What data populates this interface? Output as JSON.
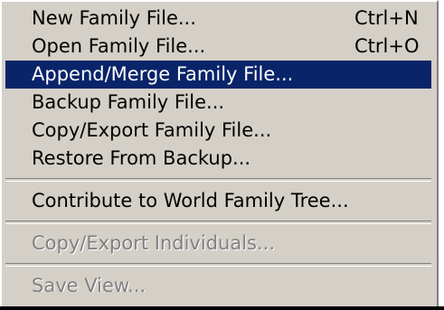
{
  "menu": {
    "items": [
      {
        "label": "New Family File...",
        "shortcut": "Ctrl+N"
      },
      {
        "label": "Open Family File...",
        "shortcut": "Ctrl+O"
      },
      {
        "label": "Append/Merge Family File..."
      },
      {
        "label": "Backup Family File..."
      },
      {
        "label": "Copy/Export Family File..."
      },
      {
        "label": "Restore From Backup..."
      },
      {
        "label": "Contribute to World Family Tree..."
      },
      {
        "label": "Copy/Export Individuals..."
      },
      {
        "label": "Save View..."
      }
    ]
  },
  "colors": {
    "menu_background": "#d4d0c8",
    "highlight": "#0a246a",
    "disabled_text": "#808080"
  }
}
